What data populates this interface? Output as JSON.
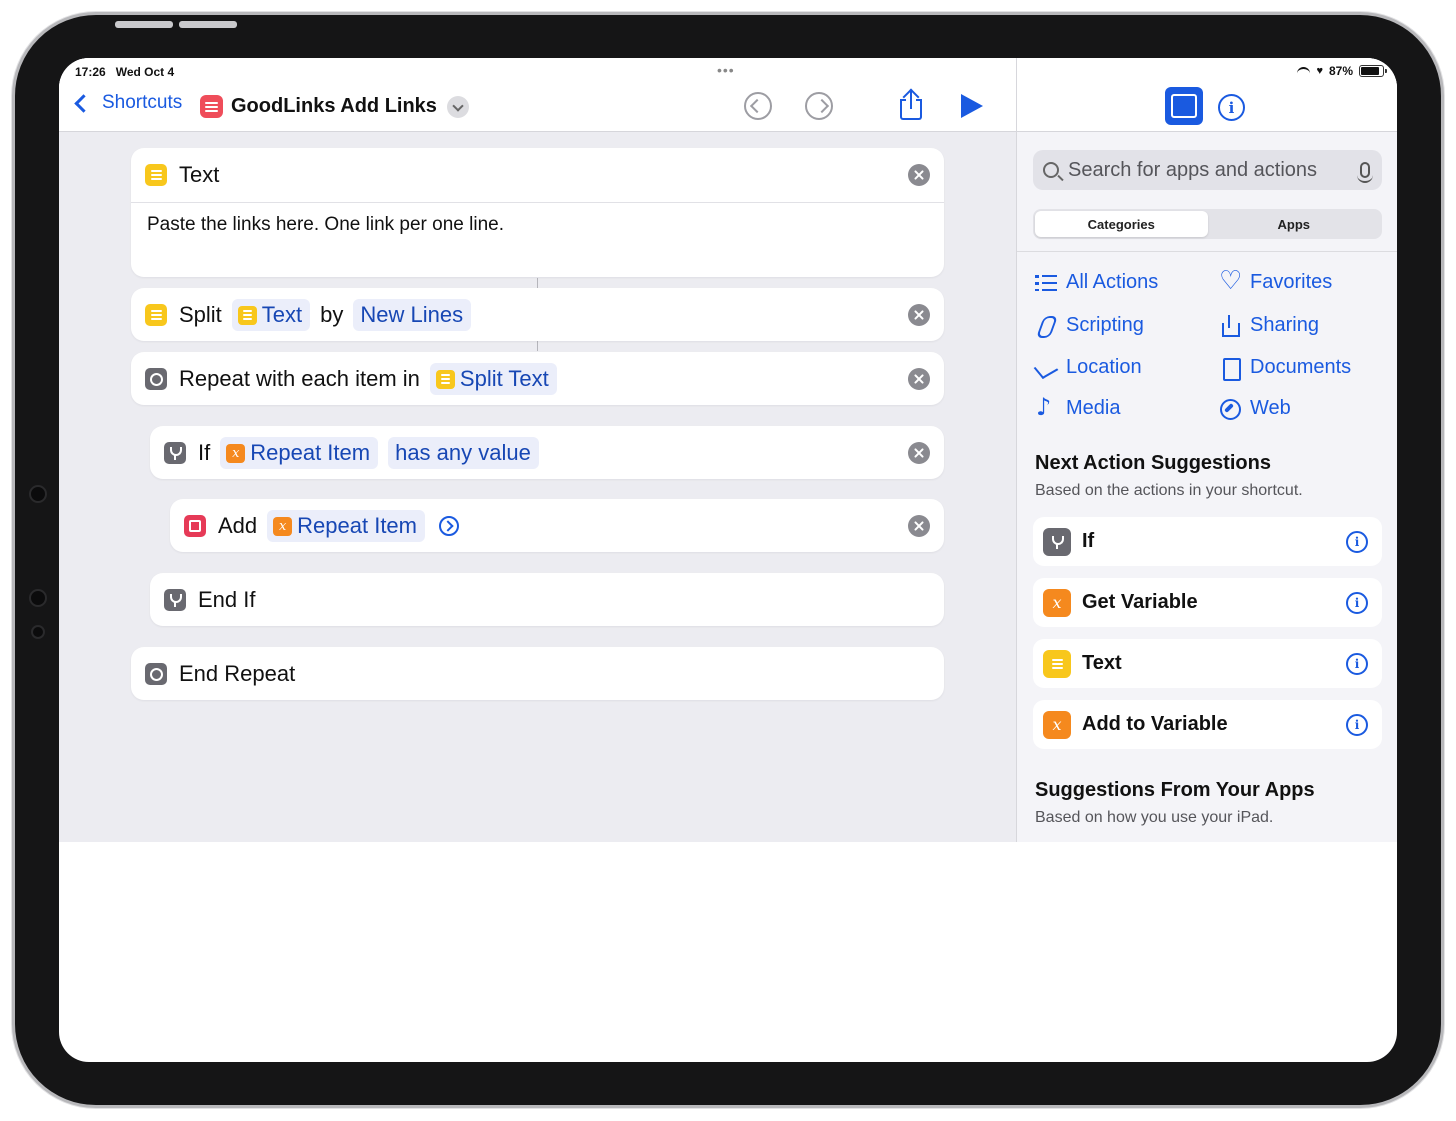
{
  "status": {
    "time": "17:26",
    "date": "Wed Oct 4",
    "battery": "87%"
  },
  "toolbar": {
    "back_label": "Shortcuts",
    "shortcut_title": "GoodLinks Add Links"
  },
  "actions": [
    {
      "id": "text",
      "label": "Text",
      "body": "Paste the links here. One link per one line."
    },
    {
      "id": "split",
      "label": "Split",
      "token": "Text",
      "by": "by",
      "param": "New Lines"
    },
    {
      "id": "repeat",
      "label": "Repeat with each item in",
      "token": "Split Text"
    },
    {
      "id": "if",
      "label": "If",
      "token": "Repeat Item",
      "condition": "has any value"
    },
    {
      "id": "add",
      "label": "Add",
      "token": "Repeat Item"
    },
    {
      "id": "endif",
      "label": "End If"
    },
    {
      "id": "endrepeat",
      "label": "End Repeat"
    }
  ],
  "sidebar": {
    "search_placeholder": "Search for apps and actions",
    "segments": [
      "Categories",
      "Apps"
    ],
    "categories": [
      "All Actions",
      "Favorites",
      "Scripting",
      "Sharing",
      "Location",
      "Documents",
      "Media",
      "Web"
    ],
    "next_title": "Next Action Suggestions",
    "next_sub": "Based on the actions in your shortcut.",
    "suggestions": [
      {
        "label": "If",
        "icon": "if-icon",
        "color": "#696970"
      },
      {
        "label": "Get Variable",
        "icon": "variable-icon",
        "color": "#f5891e"
      },
      {
        "label": "Text",
        "icon": "text-icon",
        "color": "#f8c71c"
      },
      {
        "label": "Add to Variable",
        "icon": "variable-icon",
        "color": "#f5891e"
      }
    ],
    "apps_title": "Suggestions From Your Apps",
    "apps_sub": "Based on how you use your iPad."
  },
  "colors": {
    "accent": "#1a5ae0",
    "text_action": "#f8c71c",
    "variable": "#f5891e",
    "scripting": "#696970",
    "goodlinks": "#e63a57"
  }
}
